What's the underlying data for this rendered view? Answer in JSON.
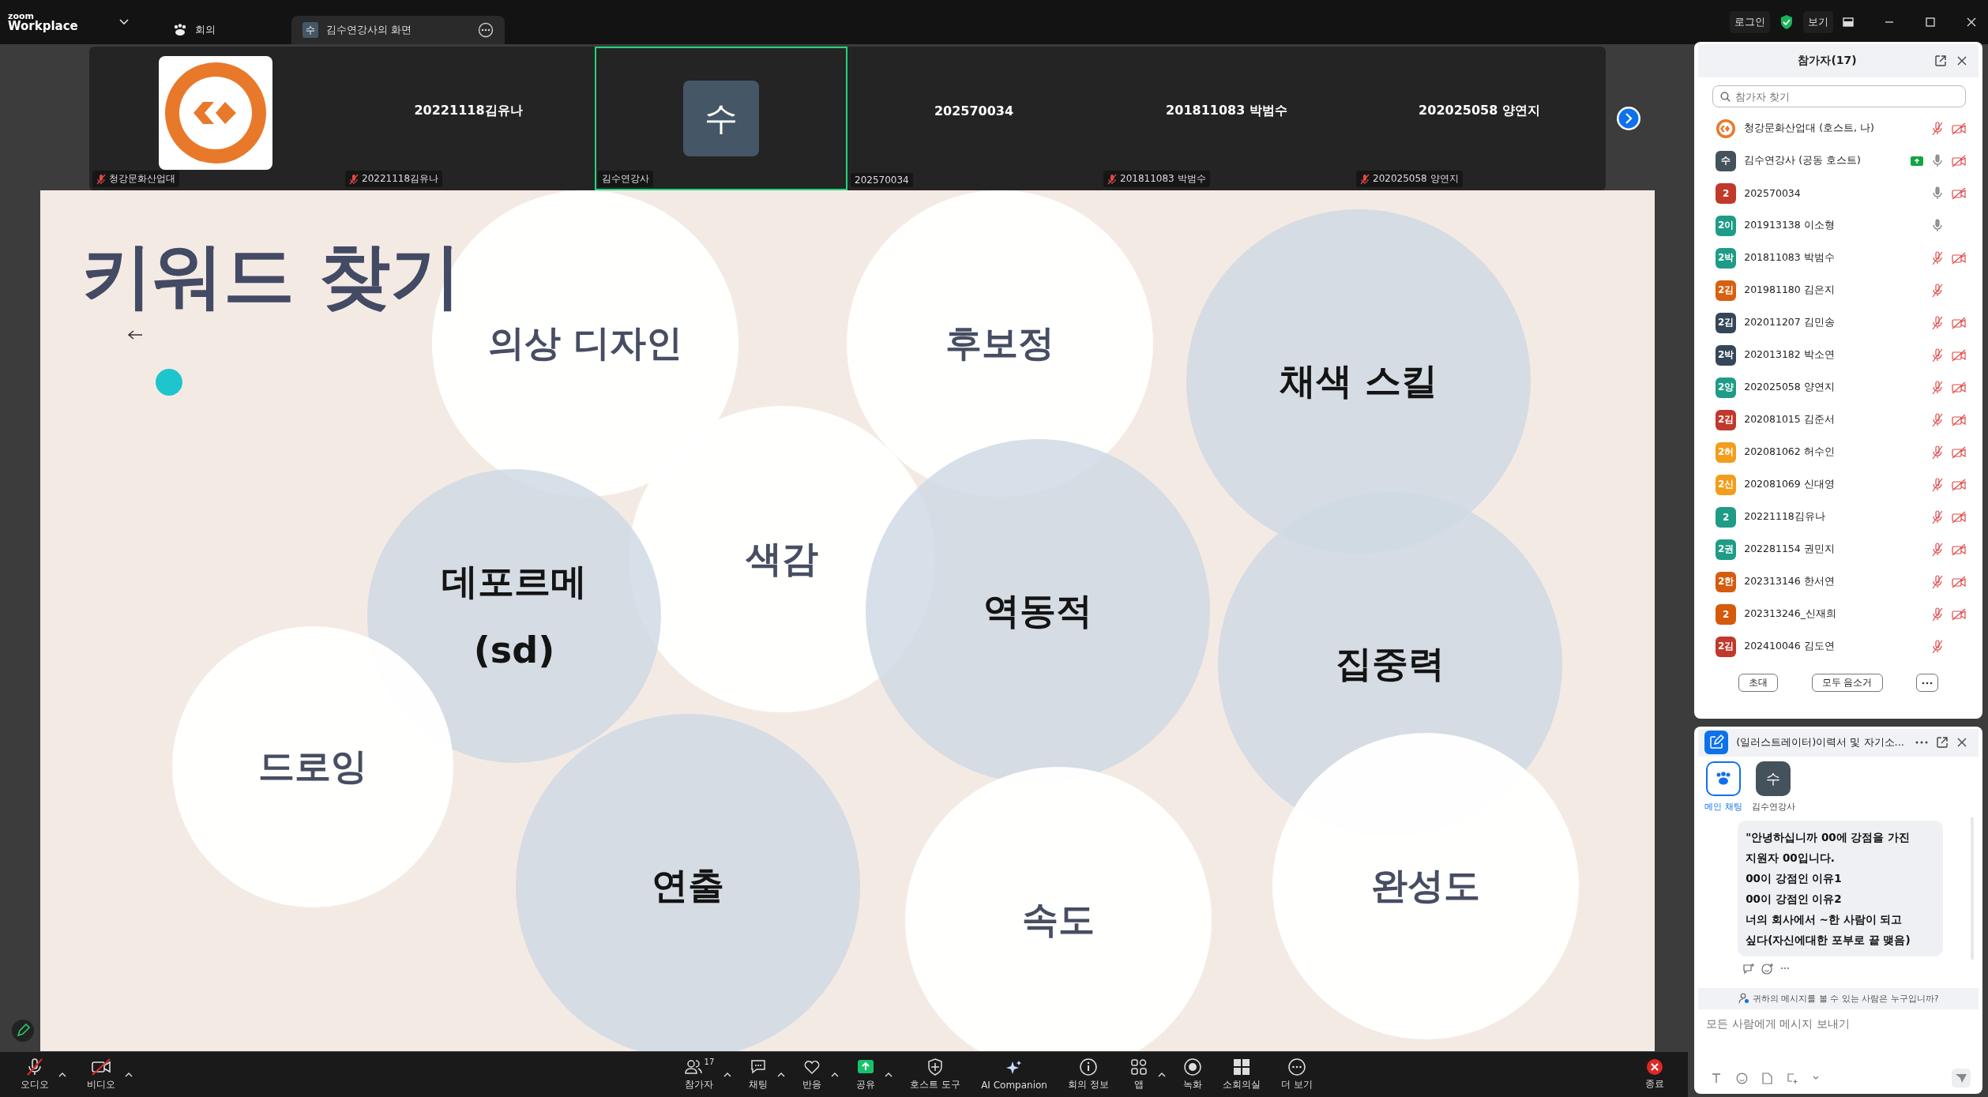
{
  "top_bar": {
    "brand_small": "zoom",
    "brand": "Workplace",
    "tabs": [
      {
        "label": "회의",
        "kind": "meeting",
        "selected": false
      },
      {
        "label": "김수연강사의 화면",
        "kind": "share",
        "avatar": "수",
        "selected": true
      }
    ],
    "login": "로그인",
    "view": "보기"
  },
  "video_strip": [
    {
      "kind": "logo",
      "name": "청강문화산업대",
      "muted": true,
      "speaking": false
    },
    {
      "kind": "name",
      "title": "20221118김유나",
      "name": "20221118김유나",
      "muted": true,
      "speaking": false
    },
    {
      "kind": "avatar",
      "avatar": "수",
      "name": "김수연강사",
      "muted": false,
      "speaking": true
    },
    {
      "kind": "name",
      "title": "202570034",
      "name": "202570034",
      "muted": false,
      "speaking": false
    },
    {
      "kind": "name",
      "title": "201811083 박범수",
      "name": "201811083 박범수",
      "muted": true,
      "speaking": false
    },
    {
      "kind": "name",
      "title": "202025058 양연지",
      "name": "202025058 양연지",
      "muted": true,
      "speaking": false
    }
  ],
  "slide": {
    "title": "키워드 찾기",
    "keywords": [
      {
        "lines": [
          "의상 디자인"
        ],
        "kind": "white"
      },
      {
        "lines": [
          "후보정"
        ],
        "kind": "white"
      },
      {
        "lines": [
          "채색 스킬"
        ],
        "kind": "blue"
      },
      {
        "lines": [
          "색감"
        ],
        "kind": "white"
      },
      {
        "lines": [
          "데포르메",
          "(sd)"
        ],
        "kind": "blue"
      },
      {
        "lines": [
          "역동적"
        ],
        "kind": "blue"
      },
      {
        "lines": [
          "집중력"
        ],
        "kind": "blue"
      },
      {
        "lines": [
          "드로잉"
        ],
        "kind": "white"
      },
      {
        "lines": [
          "연출"
        ],
        "kind": "blue"
      },
      {
        "lines": [
          "속도"
        ],
        "kind": "white"
      },
      {
        "lines": [
          "완성도"
        ],
        "kind": "white"
      }
    ]
  },
  "participants": {
    "title": "참가자(17)",
    "search": {
      "placeholder": "참가자 찾기"
    },
    "rows": [
      {
        "kind": "logo",
        "name": "청강문화산업대 (호스트, 나)",
        "mic_muted": true,
        "video_off": true,
        "sharing": false
      },
      {
        "avatar": "수",
        "color": "#44525c",
        "name": "김수연강사 (공동 호스트)",
        "mic_muted": false,
        "video_off": true,
        "sharing": true
      },
      {
        "avatar": "2",
        "color": "#c0392b",
        "name": "202570034",
        "mic_muted": false,
        "video_off": true,
        "sharing": false
      },
      {
        "avatar": "2이",
        "color": "#1e9c87",
        "name": "201913138 이소형",
        "mic_muted": false,
        "video_off": false,
        "sharing": false
      },
      {
        "avatar": "2박",
        "color": "#1e9c87",
        "name": "201811083 박범수",
        "mic_muted": true,
        "video_off": true,
        "sharing": false
      },
      {
        "avatar": "2김",
        "color": "#d9600f",
        "name": "201981180 김은지",
        "mic_muted": true,
        "video_off": false,
        "sharing": false
      },
      {
        "avatar": "2김",
        "color": "#34475a",
        "name": "202011207 김민송",
        "mic_muted": true,
        "video_off": true,
        "sharing": false
      },
      {
        "avatar": "2박",
        "color": "#34475a",
        "name": "202013182 박소연",
        "mic_muted": true,
        "video_off": true,
        "sharing": false
      },
      {
        "avatar": "2양",
        "color": "#1e9c87",
        "name": "202025058 양연지",
        "mic_muted": true,
        "video_off": true,
        "sharing": false
      },
      {
        "avatar": "2김",
        "color": "#c1392b",
        "name": "202081015 김준서",
        "mic_muted": true,
        "video_off": true,
        "sharing": false
      },
      {
        "avatar": "2허",
        "color": "#f29d1c",
        "name": "202081062 허수인",
        "mic_muted": true,
        "video_off": true,
        "sharing": false
      },
      {
        "avatar": "2신",
        "color": "#f29d1c",
        "name": "202081069 신대영",
        "mic_muted": true,
        "video_off": true,
        "sharing": false
      },
      {
        "avatar": "2",
        "color": "#1e9c87",
        "name": "20221118김유나",
        "mic_muted": true,
        "video_off": true,
        "sharing": false
      },
      {
        "avatar": "2권",
        "color": "#1e9c87",
        "name": "202281154 권민지",
        "mic_muted": true,
        "video_off": true,
        "sharing": false
      },
      {
        "avatar": "2한",
        "color": "#d55c0f",
        "name": "202313146 한서연",
        "mic_muted": true,
        "video_off": true,
        "sharing": false
      },
      {
        "avatar": "2",
        "color": "#d55a0b",
        "name": "202313246_신재희",
        "mic_muted": true,
        "video_off": true,
        "sharing": false
      },
      {
        "avatar": "2김",
        "color": "#c1392b",
        "name": "202410046 김도연",
        "mic_muted": true,
        "video_off": false,
        "sharing": false
      }
    ],
    "buttons": [
      "초대",
      "모두 음소거"
    ]
  },
  "chat": {
    "title": "(일러스트레이터)이력서 및 자기소...",
    "tabs": [
      {
        "label": "메인 채팅",
        "kind": "group",
        "selected": true
      },
      {
        "label": "김수연강사",
        "kind": "person",
        "avatar": "수",
        "selected": false
      }
    ],
    "message_lines": [
      "\"안녕하십니까 00에 강점을 가진",
      "지원자 00입니다.",
      "00이 강점인 이유1",
      "00이 강점인 이유2",
      "너의 회사에서 ~한 사람이 되고",
      "싶다(자신에대한 포부로 끝 맺음)"
    ],
    "notice": "귀하의 메시지를 볼 수 있는 사람은 누구입니까?",
    "input": {
      "placeholder": "모든 사람에게 메시지 보내기"
    }
  },
  "toolbar": {
    "left": [
      {
        "kind": "audio",
        "label": "오디오",
        "off": true,
        "caret": true
      },
      {
        "kind": "video",
        "label": "비디오",
        "off": true,
        "caret": true
      }
    ],
    "center": [
      {
        "kind": "participants",
        "label": "참가자",
        "count": "17",
        "caret": true
      },
      {
        "kind": "chat",
        "label": "채팅",
        "caret": true
      },
      {
        "kind": "reactions",
        "label": "반응",
        "caret": true
      },
      {
        "kind": "share",
        "label": "공유",
        "caret": true
      },
      {
        "kind": "host",
        "label": "호스트 도구",
        "caret": false
      },
      {
        "kind": "ai",
        "label": "AI Companion",
        "caret": false
      },
      {
        "kind": "info",
        "label": "회의 정보",
        "caret": false
      },
      {
        "kind": "apps",
        "label": "앱",
        "caret": true
      },
      {
        "kind": "record",
        "label": "녹화",
        "caret": false
      },
      {
        "kind": "rooms",
        "label": "소회의실",
        "caret": false
      },
      {
        "kind": "more",
        "label": "더 보기",
        "caret": false
      }
    ],
    "end": {
      "label": "종료"
    }
  }
}
